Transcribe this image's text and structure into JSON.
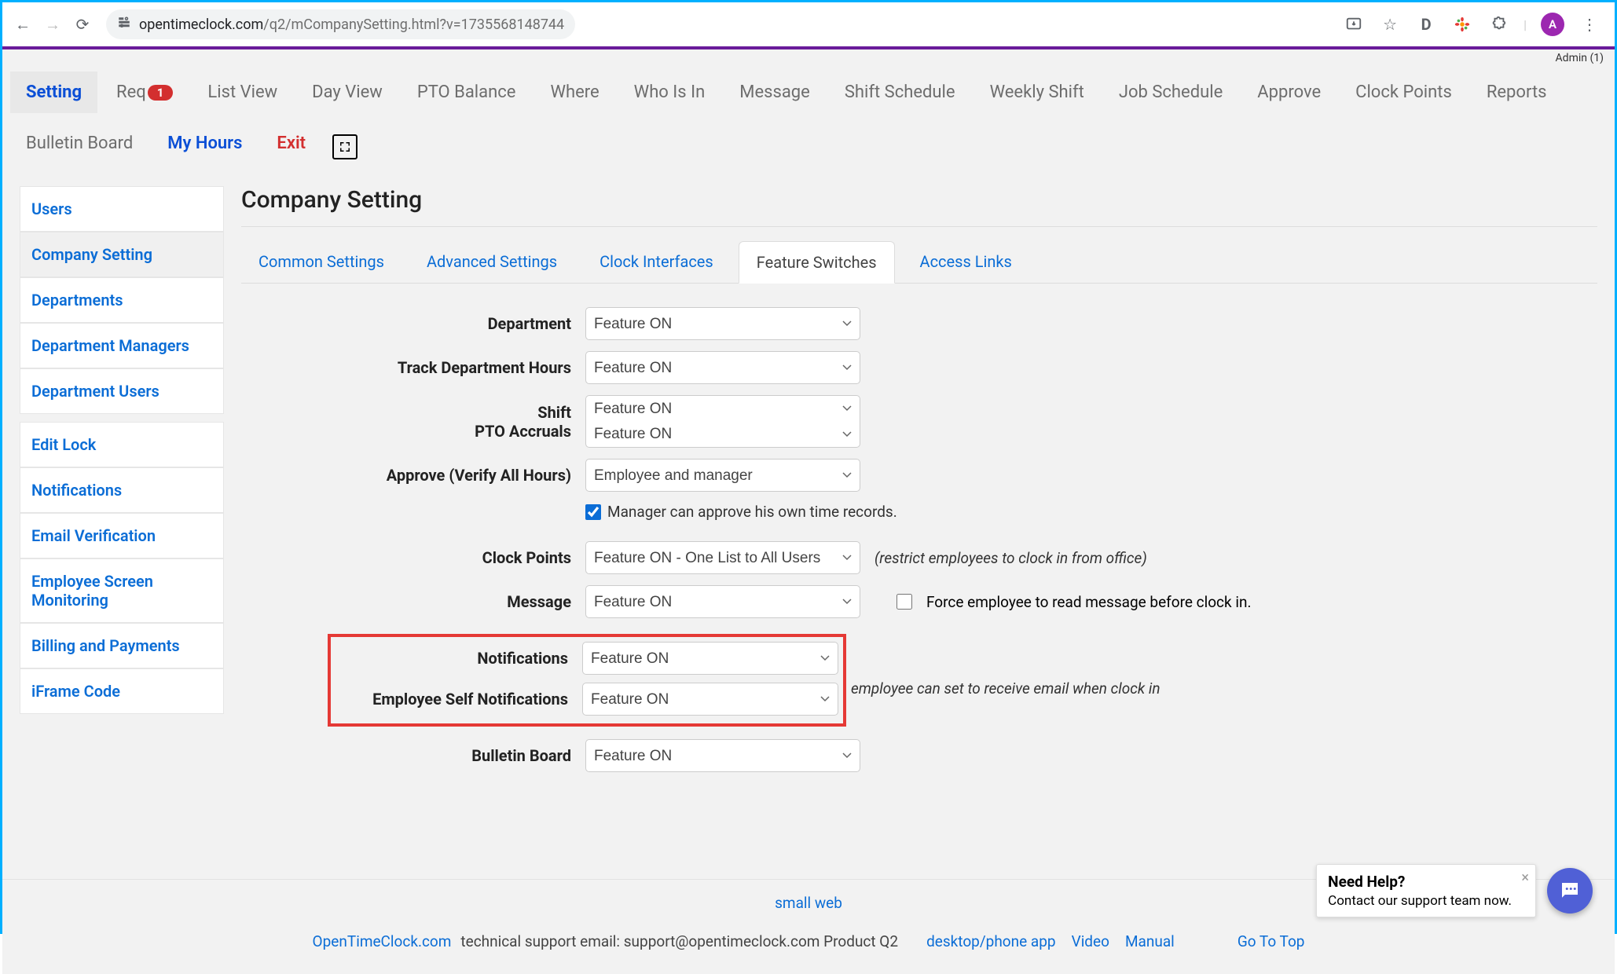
{
  "browser": {
    "url_domain": "opentimeclock.com",
    "url_path": "/q2/mCompanySetting.html?v=1735568148744",
    "avatar_letter": "A",
    "d_icon_label": "D"
  },
  "admin_label": "Admin (1)",
  "topnav": {
    "setting": "Setting",
    "request": "Req",
    "request_badge": "1",
    "list_view": "List View",
    "day_view": "Day View",
    "pto_balance": "PTO Balance",
    "where": "Where",
    "who_is_in": "Who Is In",
    "message": "Message",
    "shift_schedule": "Shift Schedule",
    "weekly_shift": "Weekly Shift",
    "job_schedule": "Job Schedule",
    "approve": "Approve",
    "clock_points": "Clock Points",
    "reports": "Reports",
    "bulletin_board": "Bulletin Board",
    "my_hours": "My Hours",
    "exit": "Exit"
  },
  "sidebar": {
    "users": "Users",
    "company_setting": "Company Setting",
    "departments": "Departments",
    "dept_managers": "Department Managers",
    "dept_users": "Department Users",
    "edit_lock": "Edit Lock",
    "notifications": "Notifications",
    "email_verify": "Email Verification",
    "monitoring": "Employee Screen Monitoring",
    "billing": "Billing and Payments",
    "iframe": "iFrame Code"
  },
  "page_title": "Company Setting",
  "subtabs": {
    "common": "Common Settings",
    "advanced": "Advanced Settings",
    "clock_interfaces": "Clock Interfaces",
    "feature_switches": "Feature Switches",
    "access_links": "Access Links"
  },
  "form": {
    "department_label": "Department",
    "department_value": "Feature ON",
    "track_dept_label": "Track Department Hours",
    "track_dept_value": "Feature ON",
    "shift_label": "Shift",
    "shift_value": "Feature ON",
    "pto_label": "PTO Accruals",
    "pto_value": "Feature ON",
    "approve_label": "Approve (Verify All Hours)",
    "approve_value": "Employee and manager",
    "manager_approve_cb": "Manager can approve his own time records.",
    "clock_points_label": "Clock Points",
    "clock_points_value": "Feature ON - One List to All Users",
    "clock_points_note": "(restrict employees to clock in from office)",
    "message_label": "Message",
    "message_value": "Feature ON",
    "message_cb": "Force employee to read message before clock in.",
    "notifications_label": "Notifications",
    "notifications_value": "Feature ON",
    "self_notify_label": "Employee Self Notifications",
    "self_notify_value": "Feature ON",
    "self_notify_note": "employee can set to receive email when clock in",
    "bulletin_label": "Bulletin Board",
    "bulletin_value": "Feature ON"
  },
  "footer": {
    "small_web": "small web",
    "brand": "OpenTimeClock.com",
    "support_text": " technical support email: support@opentimeclock.com Product Q2",
    "desktop": "desktop/phone app",
    "video": "Video",
    "manual": "Manual",
    "gototop": "Go To Top"
  },
  "help": {
    "title": "Need Help?",
    "subtitle": "Contact our support team now."
  }
}
